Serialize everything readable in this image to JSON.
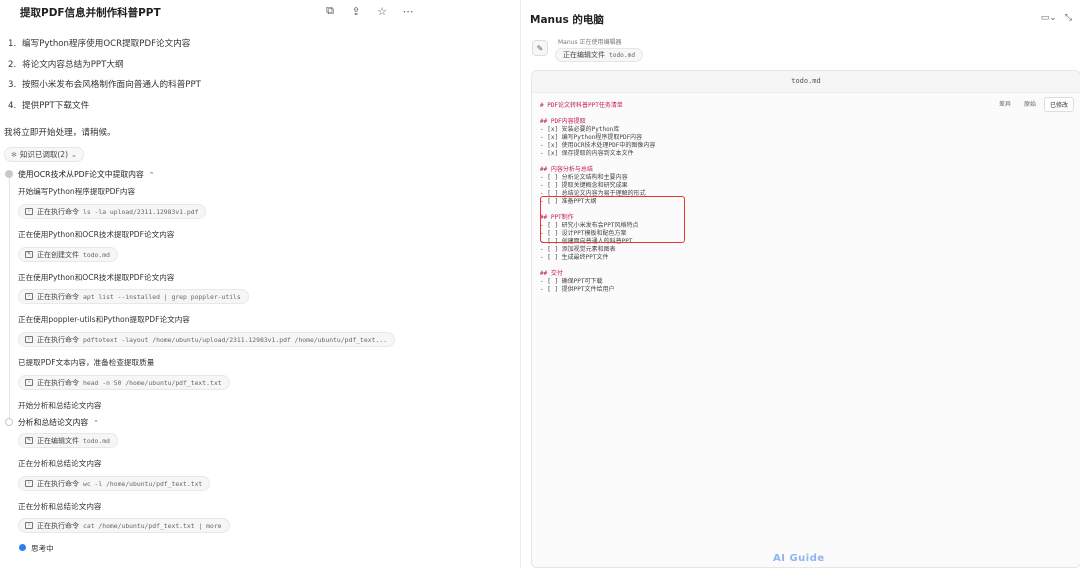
{
  "left": {
    "title": "提取PDF信息并制作科普PPT",
    "steps": [
      {
        "num": "1.",
        "text": "编写Python程序使用OCR提取PDF论文内容"
      },
      {
        "num": "2.",
        "text": "将论文内容总结为PPT大纲"
      },
      {
        "num": "3.",
        "text": "按照小米发布会风格制作面向普通人的科普PPT"
      },
      {
        "num": "4.",
        "text": "提供PPT下载文件"
      }
    ],
    "processing": "我将立即开始处理，请稍候。",
    "knowledge": "知识已调取(2)",
    "section1": "使用OCR技术从PDF论文中提取内容",
    "items": [
      {
        "type": "text",
        "text": "开始编写Python程序提取PDF内容"
      },
      {
        "type": "chip",
        "label": "正在执行命令",
        "code": "ls -la upload/2311.12983v1.pdf"
      },
      {
        "type": "text",
        "text": "正在使用Python和OCR技术提取PDF论文内容"
      },
      {
        "type": "chip",
        "label": "正在创建文件",
        "code": "todo.md"
      },
      {
        "type": "text",
        "text": "正在使用Python和OCR技术提取PDF论文内容"
      },
      {
        "type": "chip",
        "label": "正在执行命令",
        "code": "apt list --installed | grep poppler-utils"
      },
      {
        "type": "text",
        "text": "正在使用poppler-utils和Python提取PDF论文内容"
      },
      {
        "type": "chip",
        "label": "正在执行命令",
        "code": "pdftotext -layout /home/ubuntu/upload/2311.12983v1.pdf /home/ubuntu/pdf_text..."
      },
      {
        "type": "text",
        "text": "已提取PDF文本内容，准备检查提取质量"
      },
      {
        "type": "chip",
        "label": "正在执行命令",
        "code": "head -n 50 /home/ubuntu/pdf_text.txt"
      },
      {
        "type": "text",
        "text": "开始分析和总结论文内容"
      }
    ],
    "section2": "分析和总结论文内容",
    "items2": [
      {
        "type": "chip",
        "label": "正在编辑文件",
        "code": "todo.md"
      },
      {
        "type": "text",
        "text": "正在分析和总结论文内容"
      },
      {
        "type": "chip",
        "label": "正在执行命令",
        "code": "wc -l /home/ubuntu/pdf_text.txt"
      },
      {
        "type": "text",
        "text": "正在分析和总结论文内容"
      },
      {
        "type": "chip",
        "label": "正在执行命令",
        "code": "cat /home/ubuntu/pdf_text.txt | more"
      }
    ],
    "thinking": "思考中"
  },
  "right": {
    "title": "Manus 的电脑",
    "agent_status": "Manus 正在使用编辑器",
    "agent_chip_label": "正在编辑文件",
    "agent_chip_code": "todo.md",
    "file_name": "todo.md",
    "tabs": [
      "差异",
      "原始",
      "已修改"
    ],
    "active_tab": "已修改",
    "lines": [
      {
        "kind": "h1",
        "text": "# PDF论文转科普PPT任务清单"
      },
      {
        "kind": "blank",
        "text": ""
      },
      {
        "kind": "h",
        "text": "## PDF内容提取"
      },
      {
        "kind": "done",
        "text": "- [x] 安装必要的Python库"
      },
      {
        "kind": "done",
        "text": "- [x] 编写Python程序提取PDF内容"
      },
      {
        "kind": "done",
        "text": "- [x] 使用OCR技术处理PDF中的图像内容"
      },
      {
        "kind": "done",
        "text": "- [x] 保存提取的内容到文本文件"
      },
      {
        "kind": "blank",
        "text": ""
      },
      {
        "kind": "h",
        "text": "## 内容分析与总结"
      },
      {
        "kind": "todo",
        "text": "- [ ] 分析论文结构和主要内容"
      },
      {
        "kind": "todo",
        "text": "- [ ] 提取关键概念和研究成果"
      },
      {
        "kind": "todo",
        "text": "- [ ] 总结论文内容为易于理解的形式"
      },
      {
        "kind": "todo",
        "text": "- [ ] 准备PPT大纲"
      },
      {
        "kind": "blank",
        "text": ""
      },
      {
        "kind": "h",
        "text": "## PPT制作"
      },
      {
        "kind": "todo",
        "text": "- [ ] 研究小米发布会PPT风格特点"
      },
      {
        "kind": "todo",
        "text": "- [ ] 设计PPT模板和配色方案"
      },
      {
        "kind": "todo",
        "text": "- [ ] 创建面向普通人的科普PPT"
      },
      {
        "kind": "todo",
        "text": "- [ ] 添加视觉元素和图表"
      },
      {
        "kind": "todo",
        "text": "- [ ] 生成最终PPT文件"
      },
      {
        "kind": "blank",
        "text": ""
      },
      {
        "kind": "h",
        "text": "## 交付"
      },
      {
        "kind": "todo",
        "text": "- [ ] 确保PPT可下载"
      },
      {
        "kind": "todo",
        "text": "- [ ] 提供PPT文件给用户"
      }
    ]
  },
  "watermark": "AI Guide"
}
